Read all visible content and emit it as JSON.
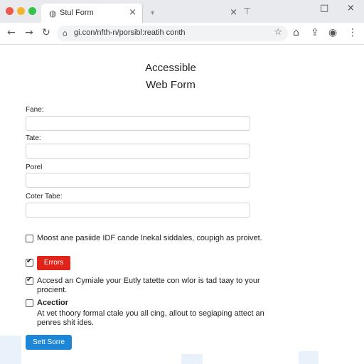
{
  "browser": {
    "tabs": [
      {
        "title": "Stul Form",
        "favicon": "page-icon",
        "close": "×"
      },
      {
        "title": "",
        "favicon": "",
        "close": "×"
      }
    ],
    "url": "gi.con/nfth-n/porsibl:reatih conth",
    "window_controls": {
      "minimize": "□",
      "close": "×"
    }
  },
  "page": {
    "heading_line1": "Accessible",
    "heading_line2": "Web Form",
    "fields": [
      {
        "label": "Fane:",
        "value": ""
      },
      {
        "label": "Tate:",
        "value": ""
      },
      {
        "label": "Porel",
        "value": ""
      },
      {
        "label": "Coter Tabe:",
        "value": ""
      }
    ],
    "checkbox1": {
      "text": "Moost ane pasiide IDF cande lnekal siddales, coupigh as proivet.",
      "checked": false
    },
    "checkbox2": {
      "button_label": "Errors",
      "checked": true
    },
    "checkbox3": {
      "text": "Accesd an Cymiale your Eutly tatette con wlor is tad taay to your procient.",
      "checked": true
    },
    "checkbox4": {
      "title": "Acectior",
      "text": "At vet thoory formal ctale you all cing, allout to segiaping attect an penres shit ides.",
      "checked": false
    },
    "submit_label": "Sett Sorre",
    "colors": {
      "error_button": "#e2231a",
      "submit_button": "#1e86d6"
    }
  }
}
